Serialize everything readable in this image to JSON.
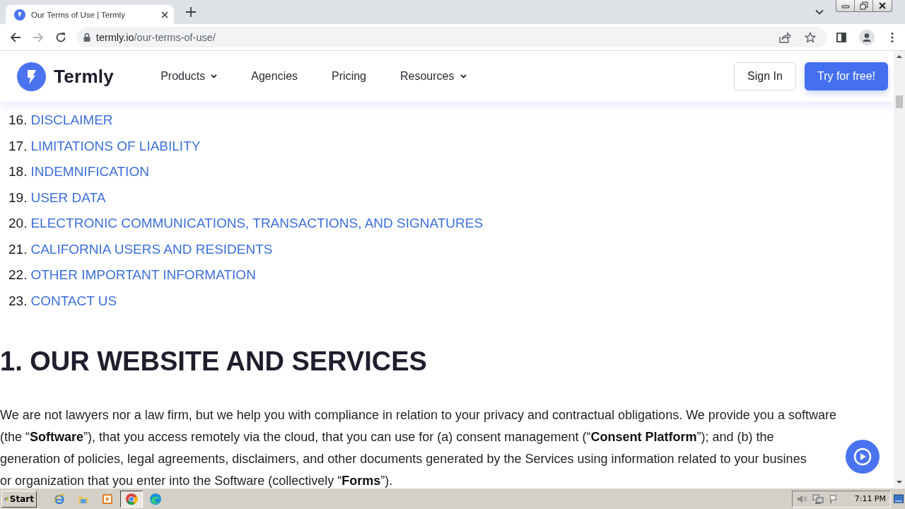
{
  "browser": {
    "tab_title": "Our Terms of Use | Termly",
    "url_host": "termly.io",
    "url_path": "/our-terms-of-use/"
  },
  "site_nav": {
    "logo": "Termly",
    "items": [
      {
        "label": "Products",
        "dropdown": true
      },
      {
        "label": "Agencies",
        "dropdown": false
      },
      {
        "label": "Pricing",
        "dropdown": false
      },
      {
        "label": "Resources",
        "dropdown": true
      }
    ],
    "sign_in": "Sign In",
    "cta": "Try for free!"
  },
  "toc": [
    {
      "number": "16.",
      "title": "DISCLAIMER"
    },
    {
      "number": "17.",
      "title": "LIMITATIONS OF LIABILITY"
    },
    {
      "number": "18.",
      "title": "INDEMNIFICATION"
    },
    {
      "number": "19.",
      "title": "USER DATA"
    },
    {
      "number": "20.",
      "title": "ELECTRONIC COMMUNICATIONS, TRANSACTIONS, AND SIGNATURES"
    },
    {
      "number": "21.",
      "title": "CALIFORNIA USERS AND RESIDENTS"
    },
    {
      "number": "22.",
      "title": "OTHER IMPORTANT INFORMATION"
    },
    {
      "number": "23.",
      "title": "CONTACT US"
    }
  ],
  "heading": "1. OUR WEBSITE AND SERVICES",
  "paragraph": {
    "lines": [
      "We are not lawyers nor a law firm, but we help you with compliance in relation to your privacy and contractual obligations. We provide you a software",
      "(the “**Software**”), that you access remotely via the cloud, that you can use for (a) consent management (“**Consent Platform**”); and (b) the",
      "generation of policies, legal agreements, disclaimers, and other documents generated by the Services using information related to your busines",
      "or organization that you enter into the Software (collectively “**Forms**”)."
    ]
  },
  "taskbar": {
    "start": "Start",
    "apps": [
      {
        "kind": "ie",
        "selected": false
      },
      {
        "kind": "folder",
        "selected": false
      },
      {
        "kind": "media",
        "selected": false
      },
      {
        "kind": "chrome",
        "selected": true
      },
      {
        "kind": "edge",
        "selected": false
      }
    ],
    "clock": "7:11 PM"
  }
}
